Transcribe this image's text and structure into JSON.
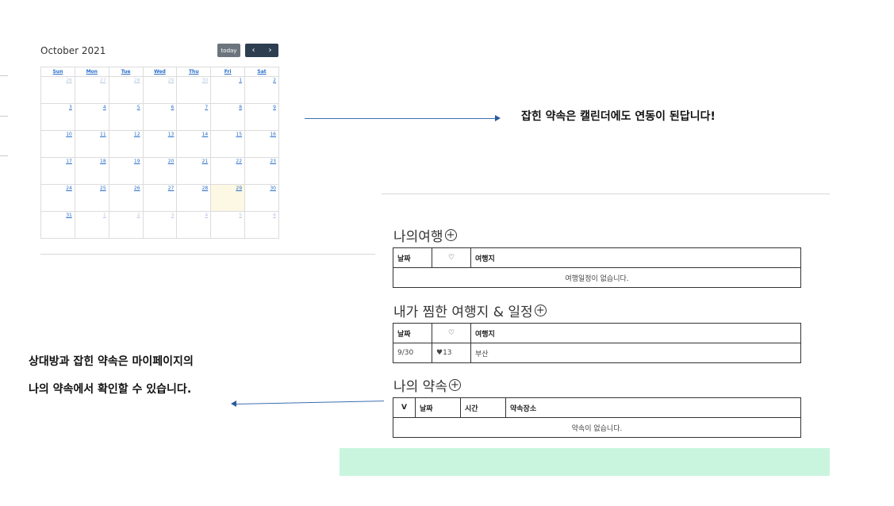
{
  "calendar": {
    "title": "October 2021",
    "today_label": "today",
    "prev_icon": "‹",
    "next_icon": "›",
    "weekdays": [
      "Sun",
      "Mon",
      "Tue",
      "Wed",
      "Thu",
      "Fri",
      "Sat"
    ],
    "weeks": [
      [
        "26",
        "27",
        "28",
        "29",
        "30",
        "1",
        "2"
      ],
      [
        "3",
        "4",
        "5",
        "6",
        "7",
        "8",
        "9"
      ],
      [
        "10",
        "11",
        "12",
        "13",
        "14",
        "15",
        "16"
      ],
      [
        "17",
        "18",
        "19",
        "20",
        "21",
        "22",
        "23"
      ],
      [
        "24",
        "25",
        "26",
        "27",
        "28",
        "29",
        "30"
      ],
      [
        "31",
        "1",
        "2",
        "3",
        "4",
        "5",
        "6"
      ]
    ]
  },
  "notes": {
    "top_right": "잡힌 약속은 캘린더에도 연동이 된답니다!",
    "left_line1": "상대방과 잡힌 약속은 마이페이지의",
    "left_line2": "나의 약속에서 확인할 수 있습니다."
  },
  "my_trips": {
    "title": "나의여행",
    "add_icon": "+",
    "columns": [
      "날짜",
      "♡",
      "여행지"
    ],
    "empty": "여행일정이 없습니다."
  },
  "liked_trips": {
    "title": "내가 찜한 여행지 & 일정",
    "add_icon": "+",
    "columns": [
      "날짜",
      "♡",
      "여행지"
    ],
    "rows": [
      {
        "date": "9/30",
        "likes": "♥13",
        "place": "부산"
      }
    ]
  },
  "my_appointments": {
    "title": "나의 약속",
    "add_icon": "+",
    "columns": [
      "V",
      "날짜",
      "시간",
      "약속장소"
    ],
    "empty": "약속이 없습니다."
  },
  "colors": {
    "calendar_link": "#2a6fc9",
    "today_highlight": "#fcf8e3",
    "mint_bar": "#c9f5df",
    "arrow": "#3b6fb0"
  }
}
